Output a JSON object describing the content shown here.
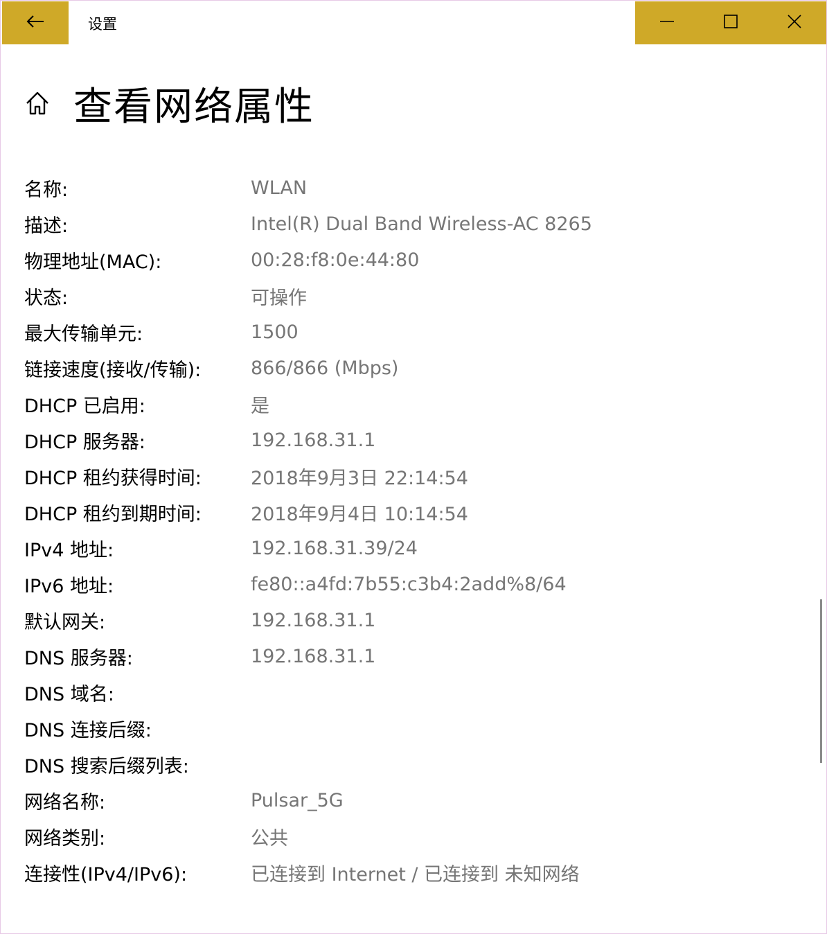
{
  "window": {
    "title": "设置",
    "accent": "#cfa928",
    "controls": [
      "minimize-icon",
      "maximize-icon",
      "close-icon"
    ]
  },
  "header": {
    "icon": "home-icon",
    "title": "查看网络属性"
  },
  "properties": [
    {
      "label": "名称:",
      "value": "WLAN"
    },
    {
      "label": "描述:",
      "value": "Intel(R) Dual Band Wireless-AC 8265"
    },
    {
      "label": "物理地址(MAC):",
      "value": "00:28:f8:0e:44:80"
    },
    {
      "label": "状态:",
      "value": "可操作"
    },
    {
      "label": "最大传输单元:",
      "value": "1500"
    },
    {
      "label": "链接速度(接收/传输):",
      "value": "866/866 (Mbps)"
    },
    {
      "label": "DHCP 已启用:",
      "value": "是"
    },
    {
      "label": "DHCP 服务器:",
      "value": "192.168.31.1"
    },
    {
      "label": "DHCP 租约获得时间:",
      "value": "2018年9月3日 22:14:54"
    },
    {
      "label": "DHCP 租约到期时间:",
      "value": "2018年9月4日 10:14:54"
    },
    {
      "label": "IPv4 地址:",
      "value": "192.168.31.39/24"
    },
    {
      "label": "IPv6 地址:",
      "value": "fe80::a4fd:7b55:c3b4:2add%8/64"
    },
    {
      "label": "默认网关:",
      "value": "192.168.31.1"
    },
    {
      "label": "DNS 服务器:",
      "value": "192.168.31.1"
    },
    {
      "label": "DNS 域名:",
      "value": ""
    },
    {
      "label": "DNS 连接后缀:",
      "value": ""
    },
    {
      "label": "DNS 搜索后缀列表:",
      "value": ""
    },
    {
      "label": "网络名称:",
      "value": "Pulsar_5G"
    },
    {
      "label": "网络类别:",
      "value": "公共"
    },
    {
      "label": "连接性(IPv4/IPv6):",
      "value": "已连接到 Internet / 已连接到 未知网络"
    }
  ]
}
